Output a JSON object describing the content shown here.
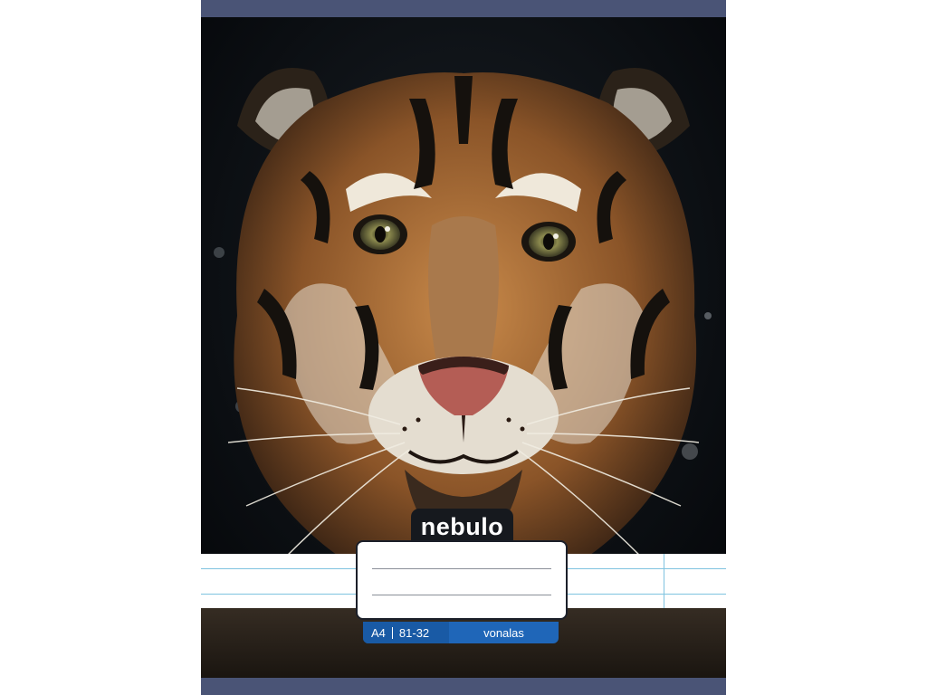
{
  "brand": {
    "name": "nebulo"
  },
  "label": {
    "format": "A4",
    "code": "81-32",
    "type": "vonalas"
  },
  "colors": {
    "band": "#4a5476",
    "label_blue": "#1f66b8",
    "rule": "#7fc3e0"
  }
}
